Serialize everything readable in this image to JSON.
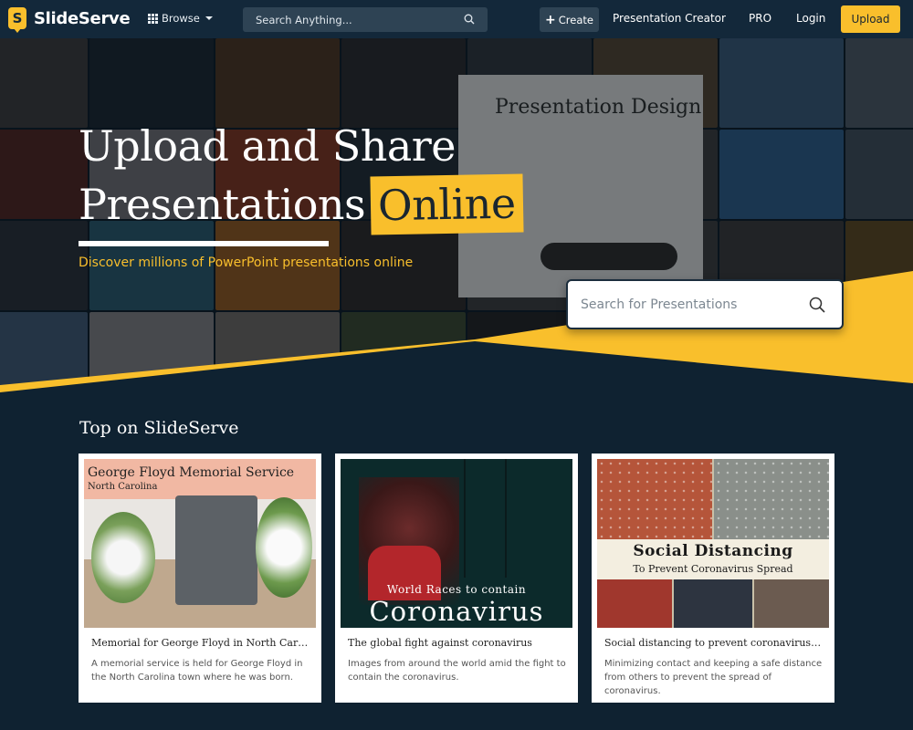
{
  "nav": {
    "logo_letter": "S",
    "logo_text": "SlideServe",
    "browse_label": "Browse",
    "search_placeholder": "Search Anything...",
    "create_label": "Create",
    "presentation_creator_label": "Presentation Creator",
    "pro_label": "PRO",
    "login_label": "Login",
    "upload_label": "Upload"
  },
  "hero": {
    "title_line1": "Upload and Share",
    "title_line2_plain": "Presentations",
    "title_line2_highlight": "Online",
    "subtitle": "Discover millions of PowerPoint presentations online",
    "search_placeholder": "Search for Presentations",
    "background_thumbnail_text": "Presentation Design"
  },
  "section": {
    "title": "Top on SlideServe"
  },
  "cards": [
    {
      "image_heading": "George Floyd Memorial Service",
      "image_subheading": "North Carolina",
      "title": "Memorial for George Floyd in North Carolina",
      "description": "A memorial service is held for George Floyd in the North Carolina town where he was born."
    },
    {
      "image_heading": "World Races to contain",
      "image_subheading": "Coronavirus",
      "title": "The global fight against coronavirus",
      "description": "Images from around the world amid the fight to contain the coronavirus."
    },
    {
      "image_heading": "Social Distancing",
      "image_subheading": "To Prevent Coronavirus Spread",
      "title": "Social distancing to prevent coronavirus spread",
      "description": "Minimizing contact and keeping a safe distance from others to prevent the spread of coronavirus."
    }
  ],
  "colors": {
    "accent": "#f9bf2c",
    "nav_bg": "#13283a",
    "page_bg": "#0f2231"
  },
  "icons": [
    "logo-icon",
    "grid-icon",
    "caret-down-icon",
    "search-icon",
    "plus-icon"
  ]
}
